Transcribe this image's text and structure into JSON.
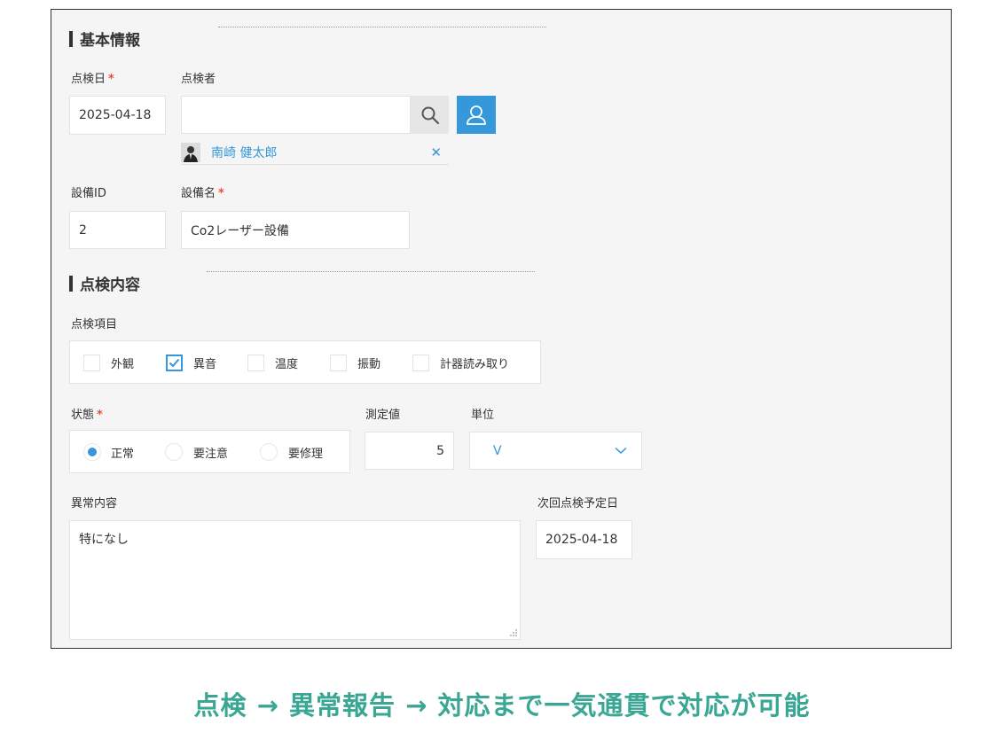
{
  "section_basic": {
    "title": "基本情報"
  },
  "inspection_date": {
    "label": "点検日",
    "required_mark": "*",
    "value": "2025-04-18"
  },
  "inspector": {
    "label": "点検者",
    "value": "",
    "selected_user": "南崎 健太郎",
    "remove_glyph": "✕"
  },
  "equipment_id": {
    "label": "設備ID",
    "value": "2"
  },
  "equipment_name": {
    "label": "設備名",
    "required_mark": "*",
    "value": "Co2レーザー設備"
  },
  "section_content": {
    "title": "点検内容"
  },
  "inspection_items": {
    "label": "点検項目",
    "options": [
      {
        "label": "外観",
        "checked": false
      },
      {
        "label": "異音",
        "checked": true
      },
      {
        "label": "温度",
        "checked": false
      },
      {
        "label": "振動",
        "checked": false
      },
      {
        "label": "計器読み取り",
        "checked": false
      }
    ]
  },
  "status": {
    "label": "状態",
    "required_mark": "*",
    "options": [
      {
        "label": "正常",
        "selected": true
      },
      {
        "label": "要注意",
        "selected": false
      },
      {
        "label": "要修理",
        "selected": false
      }
    ]
  },
  "measurement": {
    "label": "測定値",
    "value": "5"
  },
  "unit": {
    "label": "単位",
    "value": "V"
  },
  "anomaly": {
    "label": "異常内容",
    "value": "特になし"
  },
  "next_date": {
    "label": "次回点検予定日",
    "value": "2025-04-18"
  },
  "caption": {
    "text": "点検 → 異常報告 → 対応まで一気通貫で対応が可能"
  },
  "colors": {
    "accent": "#3498db",
    "required": "#e74c3c",
    "caption": "#3aa694"
  }
}
